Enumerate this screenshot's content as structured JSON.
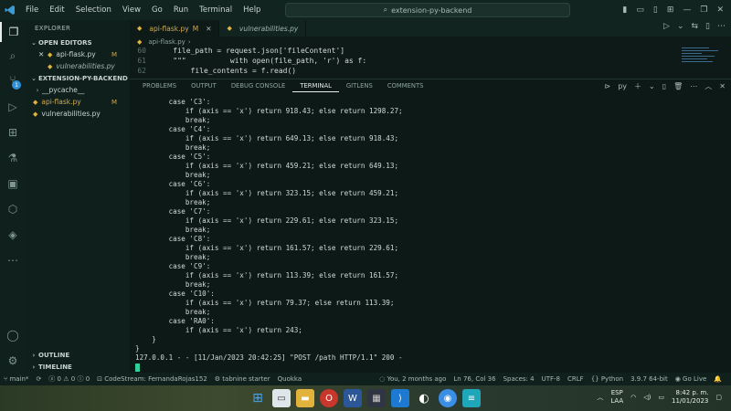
{
  "titlebar": {
    "menus": [
      "File",
      "Edit",
      "Selection",
      "View",
      "Go",
      "Run",
      "Terminal",
      "Help"
    ],
    "search_text": "extension-py-backend"
  },
  "activity": {
    "badge": "1"
  },
  "sidebar": {
    "header": "EXPLORER",
    "open_editors_label": "OPEN EDITORS",
    "open_editors": [
      {
        "name": "api-flask.py",
        "status": "M"
      },
      {
        "name": "vulnerabilities.py",
        "status": ""
      }
    ],
    "project_label": "EXTENSION-PY-BACKEND",
    "files": [
      {
        "name": "__pycache__",
        "status": ""
      },
      {
        "name": "api-flask.py",
        "status": "M"
      },
      {
        "name": "vulnerabilities.py",
        "status": ""
      }
    ],
    "outline_label": "OUTLINE",
    "timeline_label": "TIMELINE"
  },
  "editor": {
    "tabs": [
      {
        "label": "api-flask.py",
        "status": "M"
      },
      {
        "label": "vulnerabilities.py",
        "status": ""
      }
    ],
    "breadcrumb": "api-flask.py",
    "lines": [
      {
        "num": "60",
        "text": "    file_path = request.json['fileContent']"
      },
      {
        "num": "61",
        "text": "    \"\"\"          with open(file_path, 'r') as f:"
      },
      {
        "num": "62",
        "text": "        file_contents = f.read()"
      }
    ]
  },
  "panel": {
    "tabs": [
      "PROBLEMS",
      "OUTPUT",
      "DEBUG CONSOLE",
      "TERMINAL",
      "GITLENS",
      "COMMENTS"
    ],
    "active_tab": "TERMINAL",
    "terminal_name": "py",
    "terminal_lines": [
      "        case 'C3':",
      "            if (axis == 'x') return 918.43; else return 1298.27;",
      "            break;",
      "        case 'C4':",
      "            if (axis == 'x') return 649.13; else return 918.43;",
      "            break;",
      "        case 'C5':",
      "            if (axis == 'x') return 459.21; else return 649.13;",
      "            break;",
      "        case 'C6':",
      "            if (axis == 'x') return 323.15; else return 459.21;",
      "            break;",
      "        case 'C7':",
      "            if (axis == 'x') return 229.61; else return 323.15;",
      "            break;",
      "        case 'C8':",
      "            if (axis == 'x') return 161.57; else return 229.61;",
      "            break;",
      "        case 'C9':",
      "            if (axis == 'x') return 113.39; else return 161.57;",
      "            break;",
      "        case 'C10':",
      "            if (axis == 'x') return 79.37; else return 113.39;",
      "            break;",
      "        case 'RA0':",
      "            if (axis == 'x') return 243;",
      "    }",
      "}",
      "127.0.0.1 - - [11/Jan/2023 20:42:25] \"POST /path HTTP/1.1\" 200 -"
    ]
  },
  "statusbar": {
    "branch": "main*",
    "errors": "0",
    "warnings": "0",
    "info": "0",
    "codestream": "CodeStream: FernandaRojas152",
    "tabnine": "tabnine starter",
    "quokka": "Quokka",
    "blame": "You, 2 months ago",
    "position": "Ln 76, Col 36",
    "spaces": "Spaces: 4",
    "encoding": "UTF-8",
    "eol": "CRLF",
    "language": "Python",
    "interpreter": "3.9.7 64-bit",
    "golive": "Go Live"
  },
  "taskbar": {
    "lang_top": "ESP",
    "lang_bottom": "LAA",
    "time": "8:42 p. m.",
    "date": "11/01/2023"
  },
  "colors": {
    "accent": "#3c9bd6",
    "terminal_cursor": "#2fcf9a",
    "modified": "#d7a94a"
  }
}
